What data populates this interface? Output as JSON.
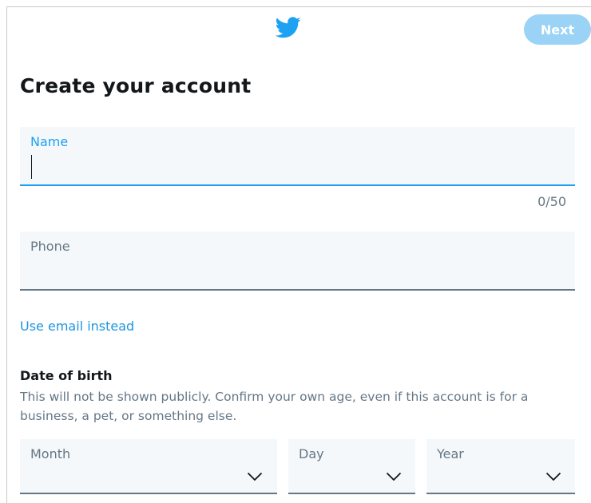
{
  "header": {
    "logo_icon": "twitter-bird-icon",
    "brand_color": "#1da1f2",
    "next_label": "Next",
    "next_color": "#9ad3f5"
  },
  "title": "Create your account",
  "name_field": {
    "label": "Name",
    "value": "",
    "counter": "0/50",
    "focused": true
  },
  "phone_field": {
    "label": "Phone",
    "value": ""
  },
  "email_link": "Use email instead",
  "dob": {
    "title": "Date of birth",
    "description": "This will not be shown publicly. Confirm your own age, even if this account is for a business, a pet, or something else.",
    "month_label": "Month",
    "day_label": "Day",
    "year_label": "Year",
    "chevron_icon": "chevron-down-icon"
  }
}
